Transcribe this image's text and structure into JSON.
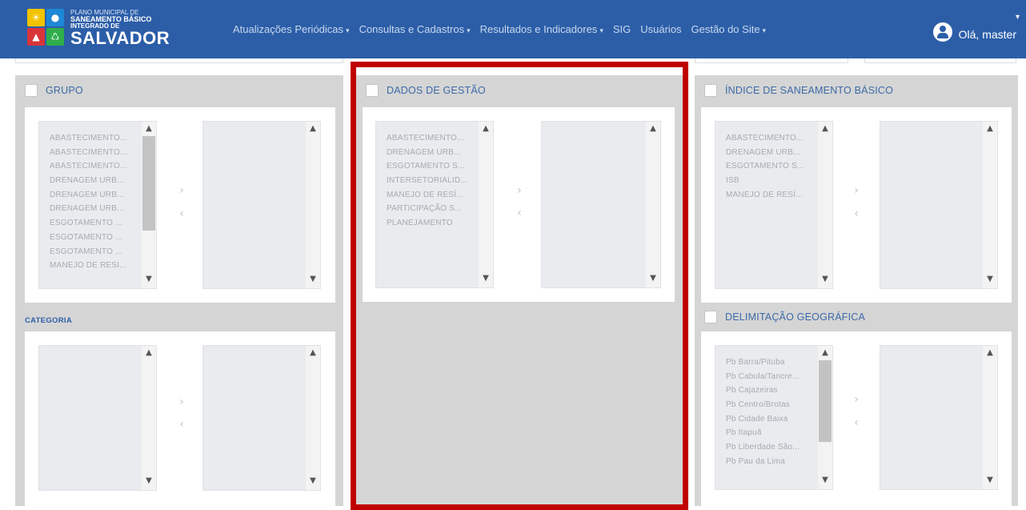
{
  "header": {
    "logo": {
      "line1": "PLANO MUNICIPAL DE",
      "line2": "SANEAMENTO BÁSICO",
      "line3": "INTEGRADO DE",
      "line4": "SALVADOR"
    },
    "nav": [
      {
        "label": "Atualizações Periódicas",
        "caret": "▾"
      },
      {
        "label": "Consultas e Cadastros",
        "caret": "▾"
      },
      {
        "label": "Resultados e Indicadores",
        "caret": "▾"
      },
      {
        "label": "SIG",
        "caret": ""
      },
      {
        "label": "Usuários",
        "caret": ""
      },
      {
        "label": "Gestão do Site",
        "caret": "▾"
      }
    ],
    "user": {
      "greeting": "Olá, master",
      "caret": "▾"
    }
  },
  "icons": {
    "up": "▲",
    "down": "▼",
    "right": "›",
    "left": "‹",
    "chevron_up": "⌃",
    "chevron_down": "⌄"
  },
  "panels": {
    "grupo": {
      "title": "GRUPO",
      "items": [
        "ABASTECIMENTO...",
        "ABASTECIMENTO...",
        "ABASTECIMENTO...",
        "DRENAGEM URB...",
        "DRENAGEM URB...",
        "DRENAGEM URB...",
        "ESGOTAMENTO ...",
        "ESGOTAMENTO ...",
        "ESGOTAMENTO ...",
        "MANEJO DE RESI..."
      ]
    },
    "categoria": {
      "title": "CATEGORIA"
    },
    "dados_gestao": {
      "title": "DADOS DE GESTÃO",
      "items": [
        "ABASTECIMENTO...",
        "DRENAGEM URB...",
        "ESGOTAMENTO S...",
        "INTERSETORIALID...",
        "MANEJO DE RESÍ...",
        "PARTICIPAÇÃO S...",
        "PLANEJAMENTO"
      ]
    },
    "indice": {
      "title": "ÍNDICE DE SANEAMENTO BÁSICO",
      "items": [
        "ABASTECIMENTO...",
        "DRENAGEM URB...",
        "ESGOTAMENTO S...",
        "ISB",
        "MANEJO DE RESÍ..."
      ]
    },
    "delimitacao": {
      "title": "DELIMITAÇÃO GEOGRÁFICA",
      "items": [
        "Pb Barra/Pituba",
        "Pb Cabula/Tancre...",
        "Pb Cajazeiras",
        "Pb Centro/Brotas",
        "Pb Cidade Baixa",
        "Pb Itapuã",
        "Pb Liberdade São...",
        "Pb Pau da Lima"
      ]
    }
  },
  "colors": {
    "header_bg": "#2c5ea8",
    "panel_bg": "#d5d5d5",
    "highlight_border": "#c00000"
  }
}
